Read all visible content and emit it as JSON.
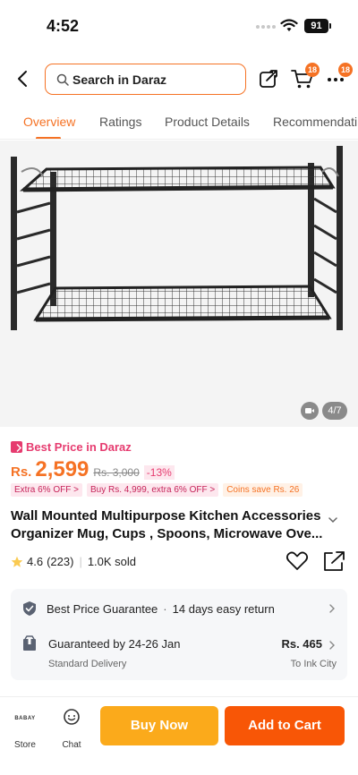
{
  "status_bar": {
    "time": "4:52",
    "battery": "91"
  },
  "header": {
    "search_placeholder": "Search in Daraz",
    "cart_badge": "18",
    "more_badge": "18"
  },
  "tabs": [
    {
      "label": "Overview",
      "active": true
    },
    {
      "label": "Ratings",
      "active": false
    },
    {
      "label": "Product Details",
      "active": false
    },
    {
      "label": "Recommendati",
      "active": false
    }
  ],
  "gallery": {
    "counter": "4/7"
  },
  "price": {
    "best_price_label": "Best Price in Daraz",
    "currency": "Rs.",
    "current": "2,599",
    "original": "Rs. 3,000",
    "discount": "-13%"
  },
  "promos": [
    {
      "text": "Extra 6% OFF >"
    },
    {
      "text": "Buy Rs. 4,999, extra 6% OFF >"
    },
    {
      "text": "Coins save Rs. 26"
    }
  ],
  "product": {
    "title": "Wall Mounted Multipurpose Kitchen Accessories Organizer Mug, Cups , Spoons, Microwave Ove...",
    "rating": "4.6",
    "review_count": "(223)",
    "sold": "1.0K sold"
  },
  "service": {
    "guarantee": "Best Price Guarantee",
    "return_policy": "14 days easy return",
    "delivery_title": "Guaranteed by 24-26 Jan",
    "delivery_type": "Standard Delivery",
    "delivery_price": "Rs. 465",
    "delivery_location": "To Ink City"
  },
  "bottom_bar": {
    "store_logo": "BABAY",
    "store_label": "Store",
    "chat_label": "Chat",
    "buy_now": "Buy Now",
    "add_to_cart": "Add to Cart"
  },
  "colors": {
    "accent": "#f57224",
    "pink": "#e63b6f",
    "buy_now": "#fbaa1b",
    "add_to_cart": "#f85606"
  }
}
